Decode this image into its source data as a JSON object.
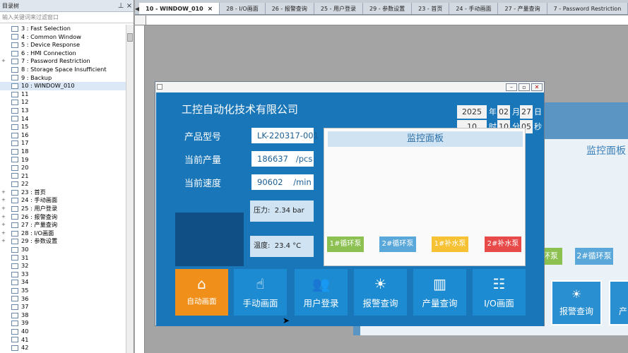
{
  "tree": {
    "title": "目录树",
    "filter_placeholder": "输入关键词来过滤窗口",
    "items": [
      {
        "label": "3 : Fast Selection",
        "expander": ""
      },
      {
        "label": "4 : Common Window",
        "expander": ""
      },
      {
        "label": "5 : Device Response",
        "expander": ""
      },
      {
        "label": "6 : HMI Connection",
        "expander": ""
      },
      {
        "label": "7 : Password Restriction",
        "expander": "+"
      },
      {
        "label": "8 : Storage Space Insufficient",
        "expander": ""
      },
      {
        "label": "9 : Backup",
        "expander": ""
      },
      {
        "label": "10 : WINDOW_010",
        "expander": "",
        "selected": true
      },
      {
        "label": "11",
        "expander": ""
      },
      {
        "label": "12",
        "expander": ""
      },
      {
        "label": "13",
        "expander": ""
      },
      {
        "label": "14",
        "expander": ""
      },
      {
        "label": "15",
        "expander": ""
      },
      {
        "label": "16",
        "expander": ""
      },
      {
        "label": "17",
        "expander": ""
      },
      {
        "label": "18",
        "expander": ""
      },
      {
        "label": "19",
        "expander": ""
      },
      {
        "label": "20",
        "expander": ""
      },
      {
        "label": "21",
        "expander": ""
      },
      {
        "label": "22",
        "expander": ""
      },
      {
        "label": "23 : 首页",
        "expander": "+"
      },
      {
        "label": "24 : 手动画面",
        "expander": "+"
      },
      {
        "label": "25 : 用户登录",
        "expander": "+"
      },
      {
        "label": "26 : 报警查询",
        "expander": "+"
      },
      {
        "label": "27 : 产量查询",
        "expander": "+"
      },
      {
        "label": "28 : I/O画面",
        "expander": "+"
      },
      {
        "label": "29 : 参数设置",
        "expander": "+"
      },
      {
        "label": "30",
        "expander": ""
      },
      {
        "label": "31",
        "expander": ""
      },
      {
        "label": "32",
        "expander": ""
      },
      {
        "label": "33",
        "expander": ""
      },
      {
        "label": "34",
        "expander": ""
      },
      {
        "label": "35",
        "expander": ""
      },
      {
        "label": "36",
        "expander": ""
      },
      {
        "label": "37",
        "expander": ""
      },
      {
        "label": "38",
        "expander": ""
      },
      {
        "label": "39",
        "expander": ""
      },
      {
        "label": "40",
        "expander": ""
      },
      {
        "label": "41",
        "expander": ""
      },
      {
        "label": "42",
        "expander": ""
      }
    ]
  },
  "tabs": [
    {
      "label": "10 - WINDOW_010",
      "active": true
    },
    {
      "label": "28 - I/O画面"
    },
    {
      "label": "26 - 报警查询"
    },
    {
      "label": "25 - 用户登录"
    },
    {
      "label": "29 - 参数设置"
    },
    {
      "label": "23 - 首页"
    },
    {
      "label": "24 - 手动画面"
    },
    {
      "label": "27 - 产量查询"
    },
    {
      "label": "7 - Password Restriction"
    }
  ],
  "hmi": {
    "company": "工控自动化技术有限公司",
    "date": {
      "year": "2025",
      "year_unit": "年",
      "month": "02",
      "month_unit": "月",
      "day": "27",
      "day_unit": "日",
      "hour": "10",
      "hour_unit": "时",
      "minute": "10",
      "minute_unit": "分",
      "second": "05",
      "second_unit": "秒"
    },
    "model_label": "产品型号",
    "model_value": "LK-220317-001",
    "output_label": "当前产量",
    "output_value": "186637   /pcs",
    "speed_label": "当前速度",
    "speed_value": "90602    /min",
    "pressure": "压力:  2.34 bar",
    "temperature": "温度:  23.4 °C",
    "monitor_title": "监控面板",
    "pumps": [
      {
        "label": "1#循环泵",
        "color": "#8cc152"
      },
      {
        "label": "2#循环泵",
        "color": "#5aa7d9"
      },
      {
        "label": "1#补水泵",
        "color": "#f6c233"
      },
      {
        "label": "2#补水泵",
        "color": "#e84a4a"
      }
    ],
    "nav": [
      {
        "label": "自动画面",
        "icon": "home-icon",
        "glyph": "⌂"
      },
      {
        "label": "手动画面",
        "icon": "chart-hand-icon",
        "glyph": "☝"
      },
      {
        "label": "用户登录",
        "icon": "users-icon",
        "glyph": "👥"
      },
      {
        "label": "报警查询",
        "icon": "bulb-icon",
        "glyph": "☀"
      },
      {
        "label": "产量查询",
        "icon": "bar-chart-icon",
        "glyph": "▥"
      },
      {
        "label": "I/O画面",
        "icon": "book-bulb-icon",
        "glyph": "☷"
      }
    ]
  },
  "background": {
    "monitor_title": "监控面板",
    "pump_1": "环泵",
    "pump_2": "2#循环泵",
    "button_label": "报警查询",
    "button_label_2": "产"
  },
  "colors": {
    "hmi_bg": "#1976b8",
    "nav_button": "#1c8bd2",
    "auto_button": "#f0901a"
  }
}
